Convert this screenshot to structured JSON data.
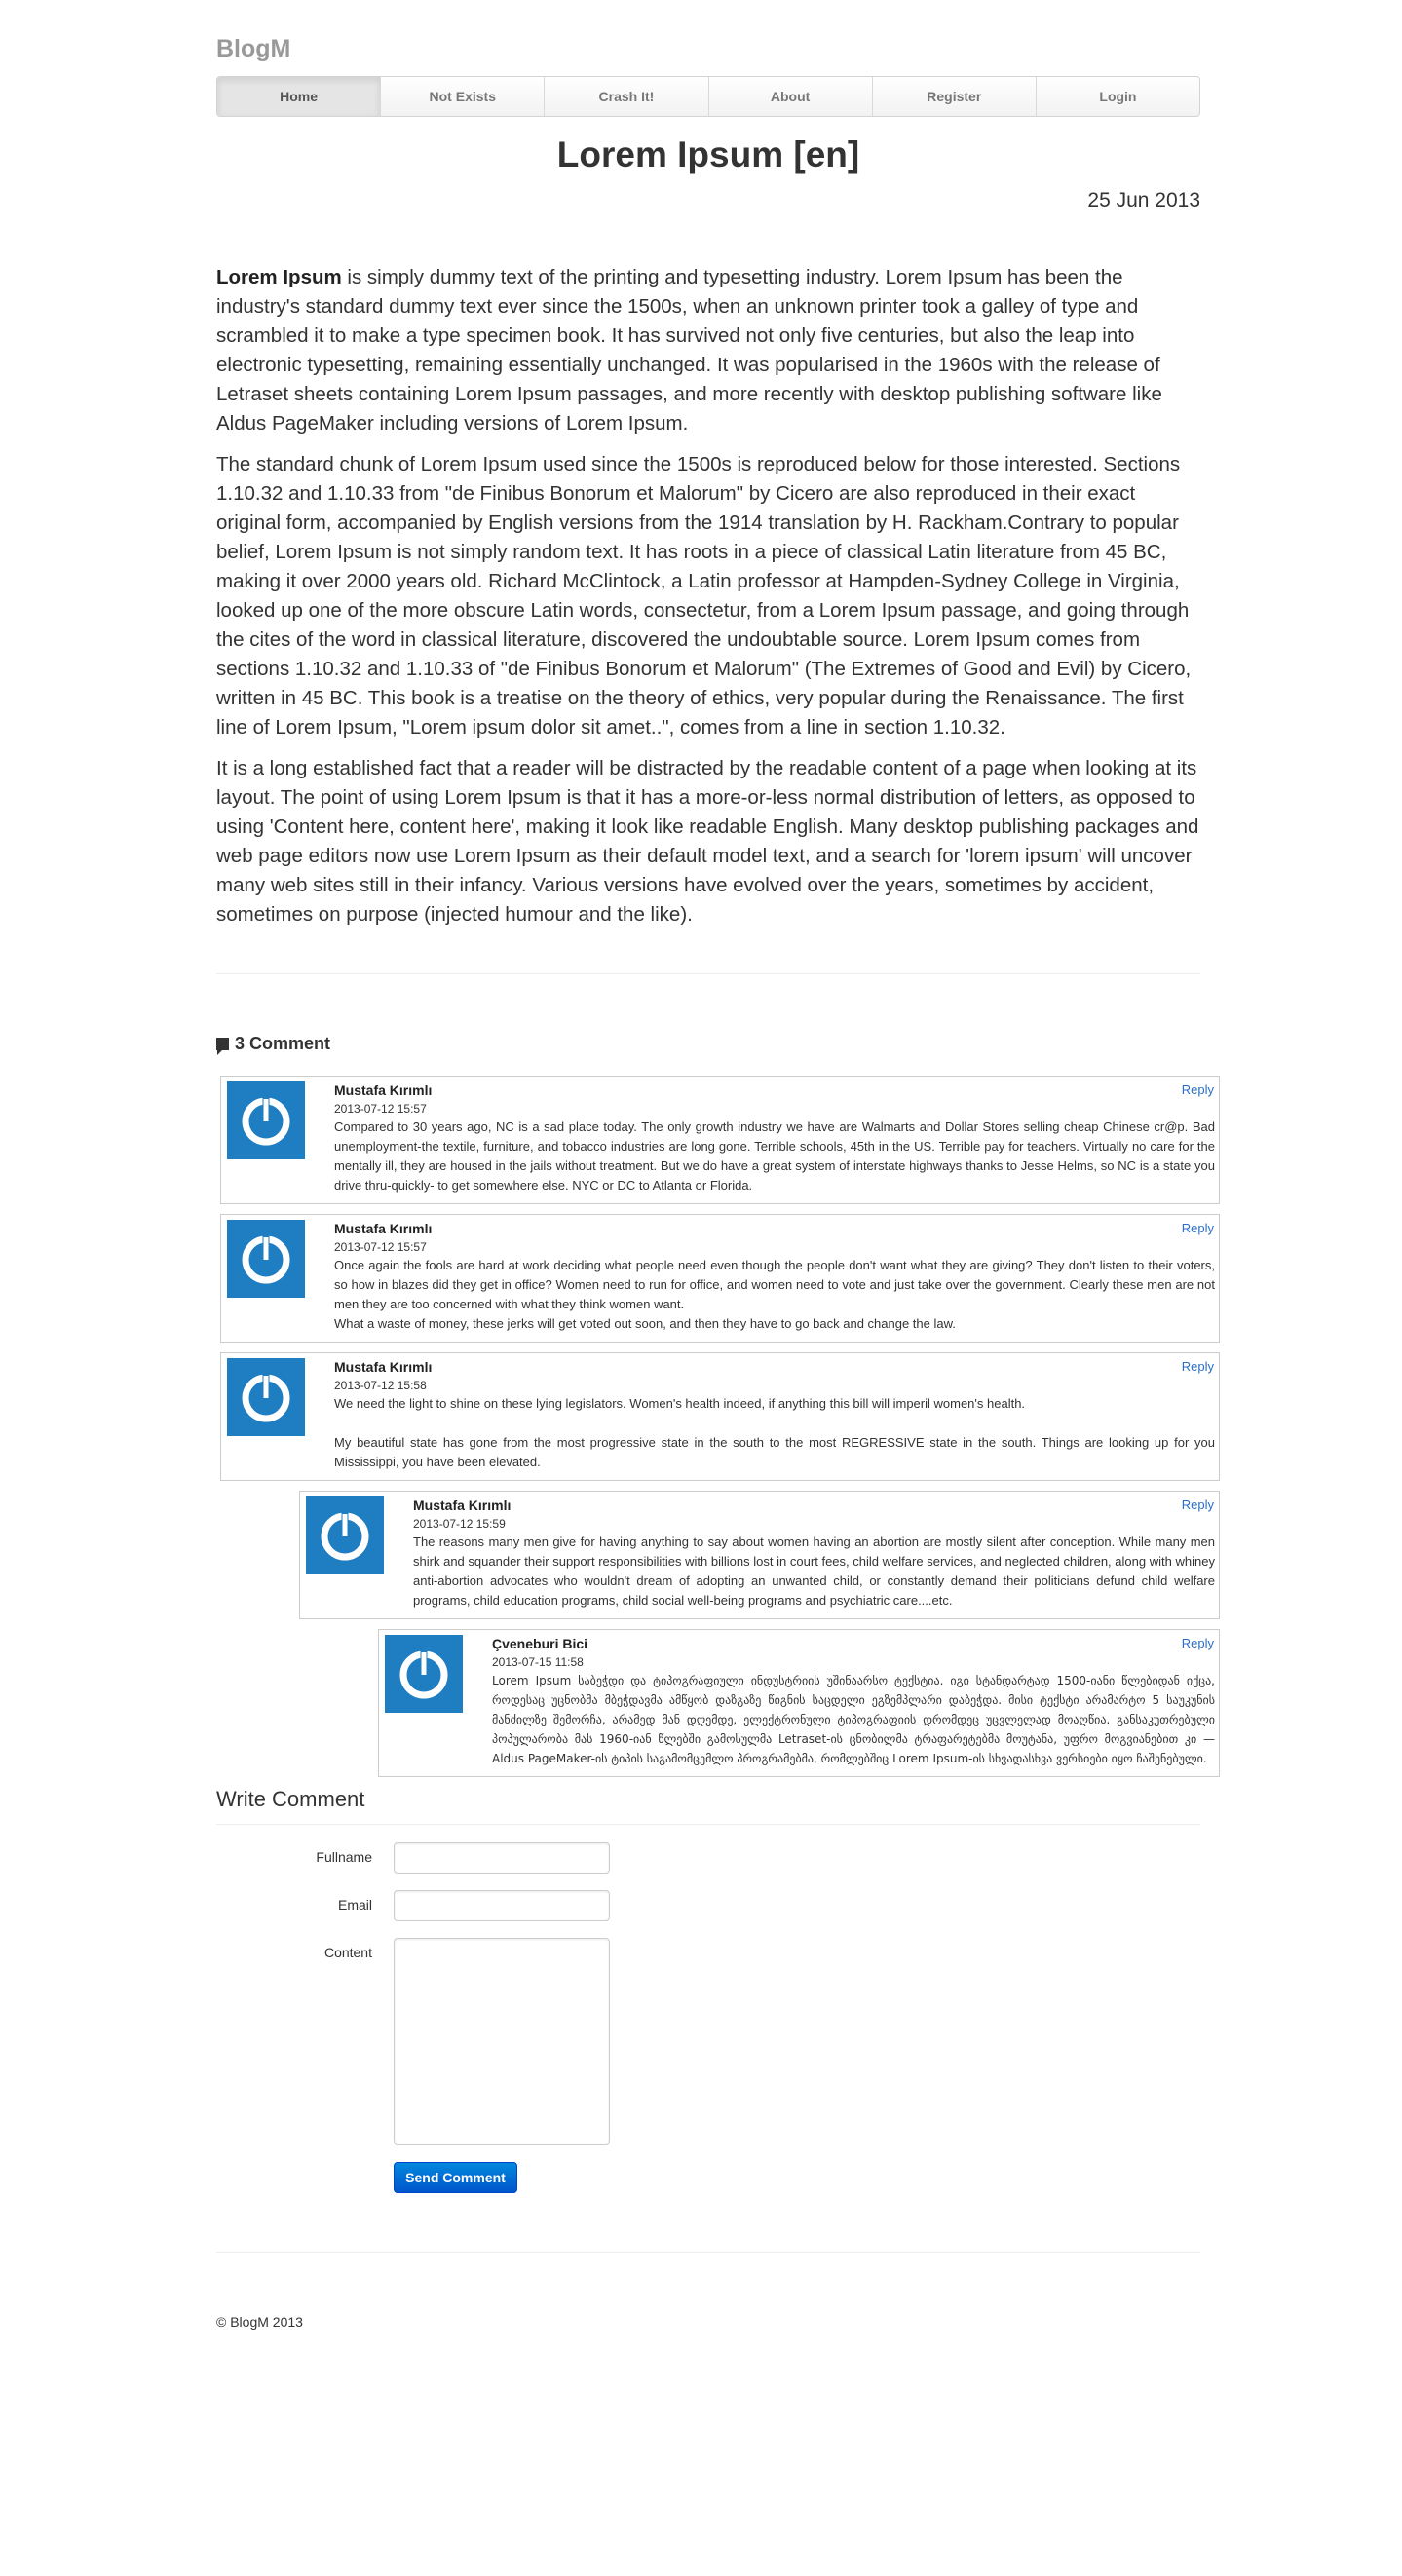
{
  "brand": "BlogM",
  "nav": [
    "Home",
    "Not Exists",
    "Crash It!",
    "About",
    "Register",
    "Login"
  ],
  "post": {
    "title": "Lorem Ipsum [en]",
    "date": "25 Jun 2013",
    "p1_bold": "Lorem Ipsum",
    "p1": " is simply dummy text of the printing and typesetting industry. Lorem Ipsum has been the industry's standard dummy text ever since the 1500s, when an unknown printer took a galley of type and scrambled it to make a type specimen book. It has survived not only five centuries, but also the leap into electronic typesetting, remaining essentially unchanged. It was popularised in the 1960s with the release of Letraset sheets containing Lorem Ipsum passages, and more recently with desktop publishing software like Aldus PageMaker including versions of Lorem Ipsum.",
    "p2": "The standard chunk of Lorem Ipsum used since the 1500s is reproduced below for those interested. Sections 1.10.32 and 1.10.33 from \"de Finibus Bonorum et Malorum\" by Cicero are also reproduced in their exact original form, accompanied by English versions from the 1914 translation by H. Rackham.Contrary to popular belief, Lorem Ipsum is not simply random text. It has roots in a piece of classical Latin literature from 45 BC, making it over 2000 years old. Richard McClintock, a Latin professor at Hampden-Sydney College in Virginia, looked up one of the more obscure Latin words, consectetur, from a Lorem Ipsum passage, and going through the cites of the word in classical literature, discovered the undoubtable source. Lorem Ipsum comes from sections 1.10.32 and 1.10.33 of \"de Finibus Bonorum et Malorum\" (The Extremes of Good and Evil) by Cicero, written in 45 BC. This book is a treatise on the theory of ethics, very popular during the Renaissance. The first line of Lorem Ipsum, \"Lorem ipsum dolor sit amet..\", comes from a line in section 1.10.32.",
    "p3": "It is a long established fact that a reader will be distracted by the readable content of a page when looking at its layout. The point of using Lorem Ipsum is that it has a more-or-less normal distribution of letters, as opposed to using 'Content here, content here', making it look like readable English. Many desktop publishing packages and web page editors now use Lorem Ipsum as their default model text, and a search for 'lorem ipsum' will uncover many web sites still in their infancy. Various versions have evolved over the years, sometimes by accident, sometimes on purpose (injected humour and the like)."
  },
  "comments_header": "3 Comment",
  "comments": [
    {
      "author": "Mustafa Kırımlı",
      "date": "2013-07-12 15:57",
      "reply": "Reply",
      "text": [
        "Compared to 30 years ago, NC is a sad place today. The only growth industry we have are Walmarts and Dollar Stores selling cheap Chinese cr@p. Bad unemployment-the textile, furniture, and tobacco industries are long gone. Terrible schools, 45th in the US. Terrible pay for teachers. Virtually no care for the mentally ill, they are housed in the jails without treatment. But we do have a great system of interstate highways thanks to Jesse Helms, so NC is a state you drive thru-quickly- to get somewhere else. NYC or DC to Atlanta or Florida."
      ]
    },
    {
      "author": "Mustafa Kırımlı",
      "date": "2013-07-12 15:57",
      "reply": "Reply",
      "text": [
        "Once again the fools are hard at work deciding what people need even though the people don't want what they are giving? They don't listen to their voters, so how in blazes did they get in office? Women need to run for office, and women need to vote and just take over the government. Clearly these men are not men they are too concerned with what they think women want.",
        "What a waste of money, these jerks will get voted out soon, and then they have to go back and change the law."
      ]
    },
    {
      "author": "Mustafa Kırımlı",
      "date": "2013-07-12 15:58",
      "reply": "Reply",
      "text": [
        "We need the light to shine on these lying legislators. Women's health indeed, if anything this bill will imperil women's health.",
        "My beautiful state has gone from the most progressive state in the south to the most REGRESSIVE state in the south. Things are looking up for you Mississippi, you have been elevated."
      ]
    },
    {
      "author": "Mustafa Kırımlı",
      "date": "2013-07-12 15:59",
      "reply": "Reply",
      "text": [
        "The reasons many men give for having anything to say about women having an abortion are mostly silent after conception. While many men shirk and squander their support responsibilities with billions lost in court fees, child welfare services, and neglected children, along with whiney anti-abortion advocates who wouldn't dream of adopting an unwanted child, or constantly demand their politicians defund child welfare programs, child education programs, child social well-being programs and psychiatric care....etc."
      ]
    },
    {
      "author": "Çveneburi Bici",
      "date": "2013-07-15 11:58",
      "reply": "Reply",
      "text": [
        "Lorem Ipsum საბეჭდი და ტიპოგრაფიული ინდუსტრიის უშინაარსო ტექსტია. იგი სტანდარტად 1500-იანი წლებიდან იქცა, როდესაც უცნობმა მბეჭდავმა ამწყობ დაზგაზე წიგნის საცდელი ეგზემპლარი დაბეჭდა. მისი ტექსტი არამარტო 5 საუკუნის მანძილზე შემორჩა, არამედ მან დღემდე, ელექტრონული ტიპოგრაფიის დრომდეც უცვლელად მოაღწია. განსაკუთრებული პოპულარობა მას 1960-იან წლებში გამოსულმა Letraset-ის ცნობილმა ტრაფარეტებმა მოუტანა, უფრო მოგვიანებით კი — Aldus PageMaker-ის ტიპის საგამომცემლო პროგრამებმა, რომლებშიც Lorem Ipsum-ის სხვადასხვა ვერსიები იყო ჩაშენებული."
      ]
    }
  ],
  "form": {
    "title": "Write Comment",
    "fullname_label": "Fullname",
    "email_label": "Email",
    "content_label": "Content",
    "send_label": "Send Comment"
  },
  "footer": "© BlogM 2013"
}
